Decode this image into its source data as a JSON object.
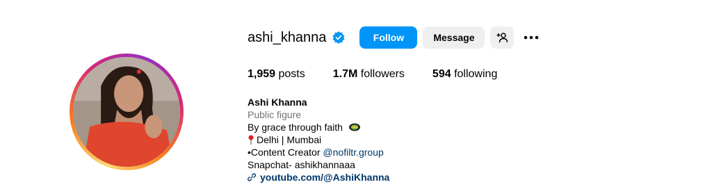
{
  "profile": {
    "username": "ashi_khanna",
    "follow_label": "Follow",
    "message_label": "Message",
    "suggest_icon": "person-add-icon",
    "more_icon": "more-horizontal-icon",
    "verified_icon": "verified-badge-icon"
  },
  "stats": {
    "posts_count": "1,959",
    "posts_label": "posts",
    "followers_count": "1.7M",
    "followers_label": "followers",
    "following_count": "594",
    "following_label": "following"
  },
  "bio": {
    "full_name": "Ashi Khanna",
    "category": "Public figure",
    "line1": "By grace through faith",
    "line2": "Delhi | Mumbai",
    "line3_prefix": "•Content Creator",
    "line3_mention": "@nofiltr.group",
    "line4": "Snapchat- ashikhannaaa",
    "link": "youtube.com/@AshiKhanna"
  },
  "colors": {
    "accent": "#0095f6",
    "link": "#00376b",
    "secondary_text": "#737373",
    "button_grey": "#efefef"
  }
}
